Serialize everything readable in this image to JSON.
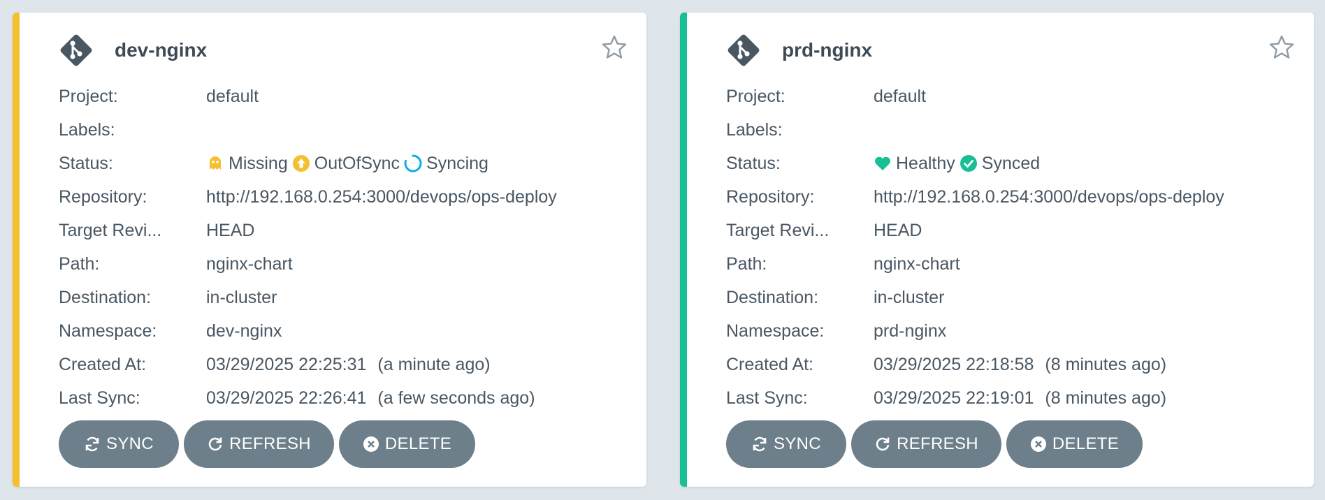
{
  "colors": {
    "background": "#dee6eb",
    "card_bar_outofsync": "#f4c030",
    "card_bar_synced": "#18be94",
    "missing": "#f4c030",
    "outofsync": "#f4c030",
    "syncing": "#0dadea",
    "healthy": "#18be94",
    "synced": "#18be94",
    "button": "#6d7f8b"
  },
  "labels": {
    "project": "Project:",
    "labels": "Labels:",
    "status": "Status:",
    "repository": "Repository:",
    "target_revision": "Target Revi...",
    "path": "Path:",
    "destination": "Destination:",
    "namespace": "Namespace:",
    "created_at": "Created At:",
    "last_sync": "Last Sync:"
  },
  "buttons": {
    "sync": "SYNC",
    "refresh": "REFRESH",
    "delete": "DELETE"
  },
  "apps": [
    {
      "name": "dev-nginx",
      "project": "default",
      "labels": "",
      "status": {
        "health": "Missing",
        "health_icon": "ghost-icon",
        "sync": "OutOfSync",
        "sync_icon": "arrow-up-circle-icon",
        "operation": "Syncing",
        "operation_icon": "spinner-icon"
      },
      "repository": "http://192.168.0.254:3000/devops/ops-deploy",
      "target_revision": "HEAD",
      "path": "nginx-chart",
      "destination": "in-cluster",
      "namespace": "dev-nginx",
      "created_at": "03/29/2025 22:25:31",
      "created_at_rel": "(a minute ago)",
      "last_sync": "03/29/2025 22:26:41",
      "last_sync_rel": "(a few seconds ago)"
    },
    {
      "name": "prd-nginx",
      "project": "default",
      "labels": "",
      "status": {
        "health": "Healthy",
        "health_icon": "heart-icon",
        "sync": "Synced",
        "sync_icon": "check-circle-icon"
      },
      "repository": "http://192.168.0.254:3000/devops/ops-deploy",
      "target_revision": "HEAD",
      "path": "nginx-chart",
      "destination": "in-cluster",
      "namespace": "prd-nginx",
      "created_at": "03/29/2025 22:18:58",
      "created_at_rel": "(8 minutes ago)",
      "last_sync": "03/29/2025 22:19:01",
      "last_sync_rel": "(8 minutes ago)"
    }
  ]
}
